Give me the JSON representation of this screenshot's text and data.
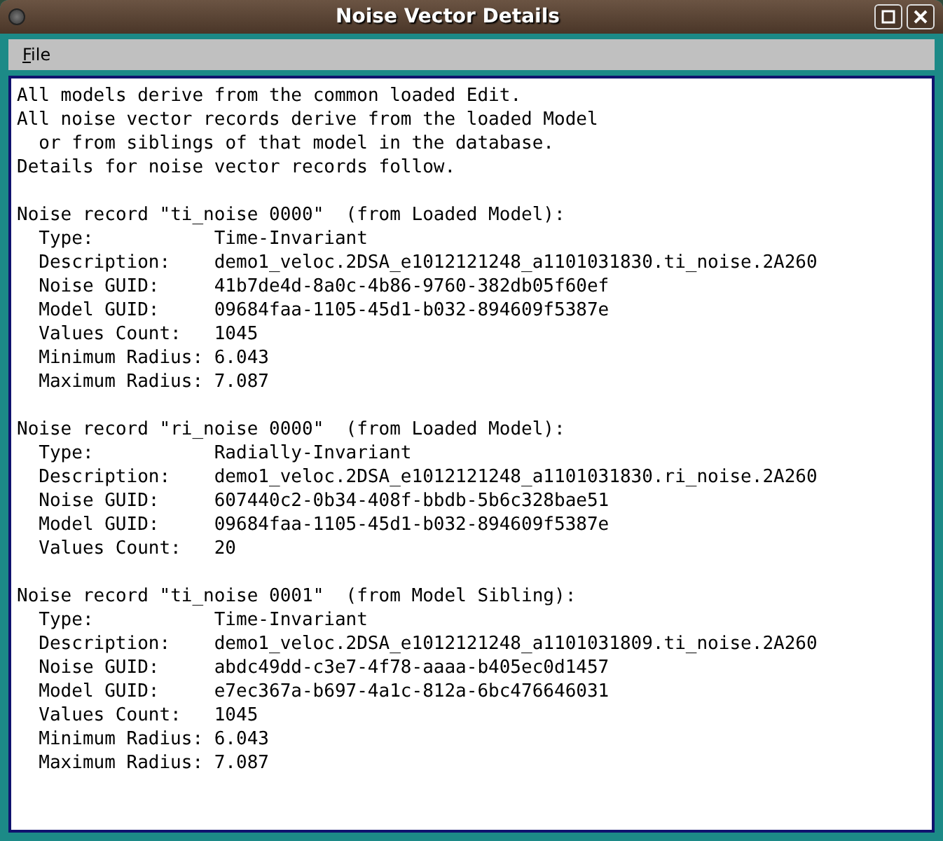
{
  "window": {
    "title": "Noise Vector Details"
  },
  "menu": [
    {
      "label": "File"
    }
  ],
  "intro": [
    {
      "text": "All models derive from the common loaded Edit.",
      "indented": false
    },
    {
      "text": "All noise vector records derive from the loaded Model",
      "indented": false
    },
    {
      "text": "or from siblings of that model in the database.",
      "indented": true
    },
    {
      "text": "Details for noise vector records follow.",
      "indented": false
    }
  ],
  "records": [
    {
      "header": "Noise record \"ti_noise 0000\"  (from Loaded Model):",
      "fields": [
        {
          "label": "Type:",
          "value": "Time-Invariant"
        },
        {
          "label": "Description:",
          "value": "demo1_veloc.2DSA_e1012121248_a1101031830.ti_noise.2A260"
        },
        {
          "label": "Noise GUID:",
          "value": "41b7de4d-8a0c-4b86-9760-382db05f60ef"
        },
        {
          "label": "Model GUID:",
          "value": "09684faa-1105-45d1-b032-894609f5387e"
        },
        {
          "label": "Values Count:",
          "value": "1045"
        },
        {
          "label": "Minimum Radius:",
          "value": "6.043"
        },
        {
          "label": "Maximum Radius:",
          "value": "7.087"
        }
      ]
    },
    {
      "header": "Noise record \"ri_noise 0000\"  (from Loaded Model):",
      "fields": [
        {
          "label": "Type:",
          "value": "Radially-Invariant"
        },
        {
          "label": "Description:",
          "value": "demo1_veloc.2DSA_e1012121248_a1101031830.ri_noise.2A260"
        },
        {
          "label": "Noise GUID:",
          "value": "607440c2-0b34-408f-bbdb-5b6c328bae51"
        },
        {
          "label": "Model GUID:",
          "value": "09684faa-1105-45d1-b032-894609f5387e"
        },
        {
          "label": "Values Count:",
          "value": "20"
        }
      ]
    },
    {
      "header": "Noise record \"ti_noise 0001\"  (from Model Sibling):",
      "fields": [
        {
          "label": "Type:",
          "value": "Time-Invariant"
        },
        {
          "label": "Description:",
          "value": "demo1_veloc.2DSA_e1012121248_a1101031809.ti_noise.2A260"
        },
        {
          "label": "Noise GUID:",
          "value": "abdc49dd-c3e7-4f78-aaaa-b405ec0d1457"
        },
        {
          "label": "Model GUID:",
          "value": "e7ec367a-b697-4a1c-812a-6bc476646031"
        },
        {
          "label": "Values Count:",
          "value": "1045"
        },
        {
          "label": "Minimum Radius:",
          "value": "6.043"
        },
        {
          "label": "Maximum Radius:",
          "value": "7.087"
        }
      ]
    }
  ]
}
